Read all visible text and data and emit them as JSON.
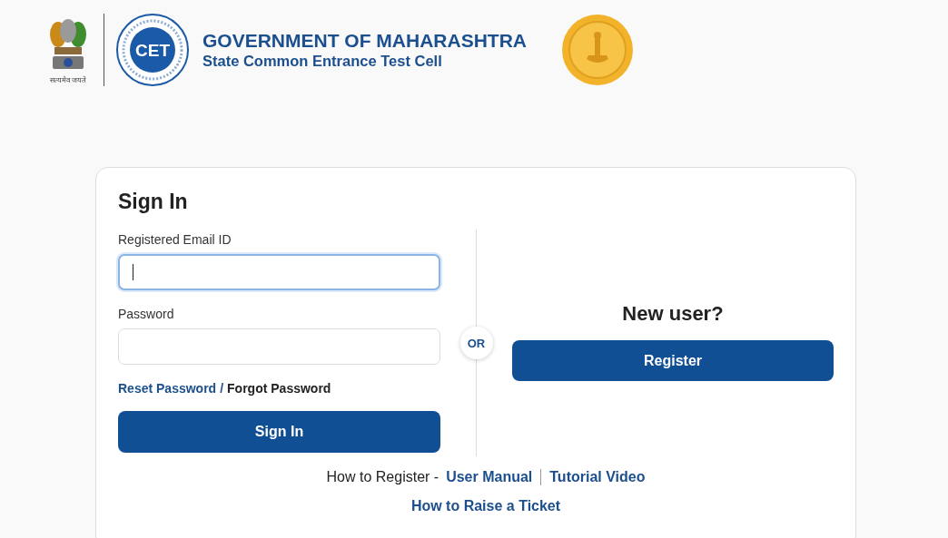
{
  "header": {
    "emblem_motto": "सत्यमेव जयते",
    "cet_logo": {
      "initials": "CET"
    },
    "title": "GOVERNMENT OF MAHARASHTRA",
    "subtitle": "State Common Entrance Test Cell"
  },
  "sign_in": {
    "heading": "Sign In",
    "fields": [
      {
        "label": "Registered Email ID",
        "focused": true
      },
      {
        "label": "Password",
        "focused": false
      }
    ],
    "reset_link": "Reset Password",
    "separator": "/",
    "forgot_link": "Forgot Password",
    "button": "Sign In"
  },
  "divider_label": "OR",
  "register": {
    "heading": "New user?",
    "button": "Register"
  },
  "help": {
    "prefix": "How to Register -",
    "links": [
      "User Manual",
      "Tutorial Video"
    ],
    "ticket_link": "How to Raise a Ticket"
  }
}
